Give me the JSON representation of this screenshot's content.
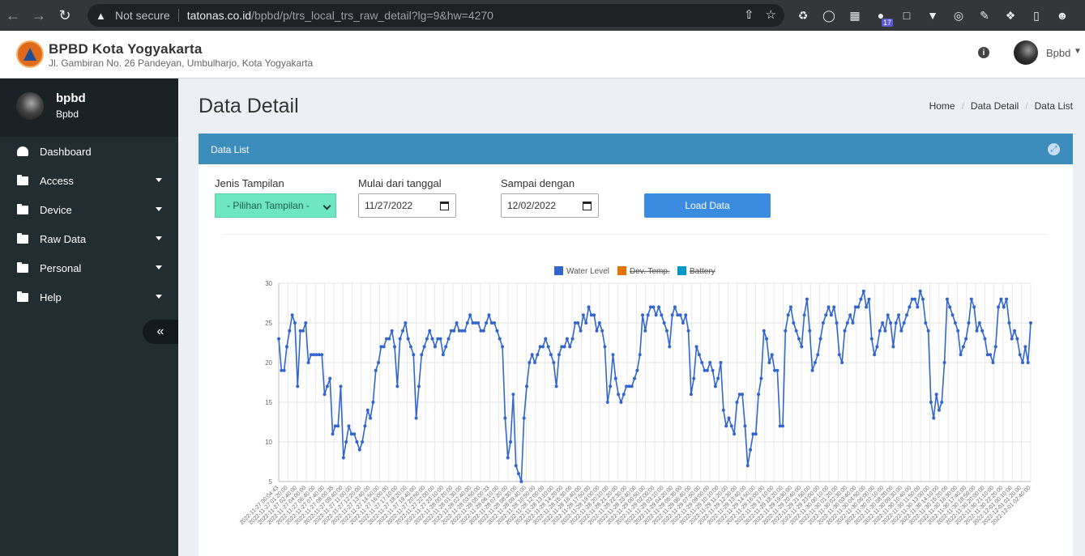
{
  "browser": {
    "not_secure": "Not secure",
    "url_host": "tatonas.co.id",
    "url_path": "/bpbd/p/trs_local_trs_raw_detail?lg=9&hw=4270",
    "ext_badge": "17"
  },
  "header": {
    "org_name": "BPBD Kota Yogyakarta",
    "org_address": "Jl. Gambiran No. 26 Pandeyan, Umbulharjo, Kota Yogyakarta",
    "user_name": "Bpbd"
  },
  "sidebar": {
    "user_name": "bpbd",
    "user_role": "Bpbd",
    "items": [
      {
        "label": "Dashboard",
        "icon": "dashboard-icon"
      },
      {
        "label": "Access",
        "icon": "folder-icon"
      },
      {
        "label": "Device",
        "icon": "folder-icon"
      },
      {
        "label": "Raw Data",
        "icon": "folder-icon"
      },
      {
        "label": "Personal",
        "icon": "folder-icon"
      },
      {
        "label": "Help",
        "icon": "folder-icon"
      }
    ],
    "toggle_label": "«"
  },
  "page": {
    "title": "Data Detail",
    "breadcrumb": [
      "Home",
      "Data Detail",
      "Data List"
    ]
  },
  "box": {
    "title": "Data List",
    "form": {
      "jenis_label": "Jenis Tampilan",
      "jenis_value": "- Pilihan Tampilan -",
      "from_label": "Mulai dari tanggal",
      "from_value": "11/27/2022",
      "to_label": "Sampai dengan",
      "to_value": "12/02/2022",
      "load_label": "Load Data"
    }
  },
  "colors": {
    "water_level": "#3366cc",
    "dev_temp": "#e67300",
    "battery": "#0099c6"
  },
  "chart_data": {
    "type": "line",
    "series": [
      {
        "name": "Water Level",
        "visible": true,
        "values": [
          23,
          19,
          19,
          22,
          24,
          26,
          25,
          17,
          24,
          24,
          25,
          20,
          21,
          21,
          21,
          21,
          21,
          16,
          17,
          18,
          11,
          12,
          12,
          17,
          8,
          10,
          12,
          11,
          11,
          10,
          9,
          10,
          12,
          14,
          13,
          15,
          19,
          20,
          22,
          22,
          23,
          23,
          24,
          22,
          17,
          23,
          24,
          25,
          23,
          22,
          21,
          13,
          17,
          21,
          22,
          23,
          24,
          23,
          22,
          23,
          23,
          21,
          22,
          23,
          24,
          24,
          25,
          24,
          24,
          24,
          25,
          26,
          25,
          25,
          25,
          24,
          24,
          25,
          26,
          25,
          25,
          24,
          23,
          22,
          13,
          8,
          10,
          16,
          7,
          6,
          5,
          13,
          17,
          20,
          21,
          20,
          21,
          22,
          22,
          23,
          22,
          21,
          20,
          17,
          21,
          22,
          22,
          23,
          22,
          23,
          25,
          25,
          24,
          26,
          25,
          27,
          26,
          26,
          24,
          25,
          24,
          22,
          15,
          17,
          21,
          18,
          16,
          15,
          16,
          17,
          17,
          17,
          18,
          19,
          21,
          26,
          24,
          26,
          27,
          27,
          26,
          27,
          26,
          25,
          24,
          22,
          26,
          27,
          26,
          26,
          25,
          26,
          24,
          16,
          18,
          22,
          21,
          20,
          19,
          19,
          20,
          19,
          17,
          18,
          20,
          14,
          12,
          13,
          12,
          11,
          15,
          16,
          16,
          12,
          7,
          9,
          11,
          11,
          16,
          18,
          24,
          23,
          20,
          21,
          19,
          19,
          12,
          12,
          24,
          26,
          27,
          25,
          24,
          23,
          22,
          26,
          28,
          24,
          19,
          20,
          21,
          23,
          25,
          26,
          27,
          26,
          27,
          25,
          21,
          20,
          24,
          25,
          26,
          25,
          27,
          27,
          28,
          29,
          27,
          28,
          23,
          21,
          22,
          24,
          25,
          24,
          26,
          25,
          22,
          25,
          26,
          24,
          25,
          26,
          27,
          28,
          28,
          27,
          29,
          28,
          25,
          24,
          15,
          13,
          16,
          14,
          15,
          20,
          28,
          27,
          26,
          25,
          24,
          21,
          22,
          23,
          25,
          28,
          27,
          24,
          25,
          24,
          23,
          21,
          21,
          20,
          22,
          27,
          28,
          27,
          28,
          25,
          23,
          24,
          23,
          21,
          20,
          22,
          20,
          25
        ]
      },
      {
        "name": "Dev. Temp.",
        "visible": false
      },
      {
        "name": "Battery",
        "visible": false
      }
    ],
    "x_labels": [
      "2022-11-27 00:04:43",
      "2022-11-27 01:20:00",
      "2022-11-27 02:40:00",
      "2022-11-27 04:00:00",
      "2022-11-27 06:40:00",
      "2022-11-27 07:40:00",
      "2022-11-27 08:00:35",
      "2022-11-27 09:40:00",
      "2022-11-27 11:00:00",
      "2022-11-27 12:20:00",
      "2022-11-27 13:40:00",
      "2022-11-27 14:50:00",
      "2022-11-27 16:00:00",
      "2022-11-27 17:10:00",
      "2022-11-27 18:20:00",
      "2022-11-27 19:40:00",
      "2022-11-27 20:50:00",
      "2022-11-27 22:00:00",
      "2022-11-27 23:10:00",
      "2022-11-28 00:20:00",
      "2022-11-28 01:30:00",
      "2022-11-28 02:40:00",
      "2022-11-28 03:50:00",
      "2022-11-28 05:00:33",
      "2022-11-28 06:10:00",
      "2022-11-28 07:20:00",
      "2022-11-28 08:30:00",
      "2022-11-28 09:40:00",
      "2022-11-28 10:50:00",
      "2022-11-28 12:00:00",
      "2022-11-28 13:10:00",
      "2022-11-28 14:20:00",
      "2022-11-28 15:30:00",
      "2022-11-28 16:40:00",
      "2022-11-28 17:50:00",
      "2022-11-28 19:00:00",
      "2022-11-28 20:10:00",
      "2022-11-28 21:20:00",
      "2022-11-28 22:30:00",
      "2022-11-28 23:40:00",
      "2022-11-29 00:50:00",
      "2022-11-29 02:00:00",
      "2022-11-29 03:10:00",
      "2022-11-29 04:20:00",
      "2022-11-29 05:30:00",
      "2022-11-29 06:40:00",
      "2022-11-29 07:50:00",
      "2022-11-29 09:00:00",
      "2022-11-29 10:10:00",
      "2022-11-29 11:20:00",
      "2022-11-29 12:30:00",
      "2022-11-29 13:40:00",
      "2022-11-29 14:50:00",
      "2022-11-29 16:00:00",
      "2022-11-29 17:10:00",
      "2022-11-29 18:20:00",
      "2022-11-29 19:30:00",
      "2022-11-29 20:40:00",
      "2022-11-29 21:50:00",
      "2022-11-29 23:00:00",
      "2022-11-30 00:10:00",
      "2022-11-30 01:20:00",
      "2022-11-30 02:30:00",
      "2022-11-30 03:40:00",
      "2022-11-30 04:50:00",
      "2022-11-30 06:00:00",
      "2022-11-30 07:10:00",
      "2022-11-30 08:20:00",
      "2022-11-30 09:30:00",
      "2022-11-30 10:40:00",
      "2022-11-30 11:50:00",
      "2022-11-30 13:00:00",
      "2022-11-30 14:10:00",
      "2022-11-30 15:20:00",
      "2022-11-30 16:30:00",
      "2022-11-30 17:40:00",
      "2022-11-30 18:50:00",
      "2022-11-30 20:00:00",
      "2022-11-30 21:10:00",
      "2022-11-30 22:20:00",
      "2022-12-01 00:10:00",
      "2022-12-01 01:20:00",
      "2022-12-01 02:40:00"
    ],
    "y_ticks": [
      5,
      10,
      15,
      20,
      25,
      30
    ],
    "ylim": [
      5,
      30
    ],
    "legend_position": "top",
    "grid": true
  }
}
